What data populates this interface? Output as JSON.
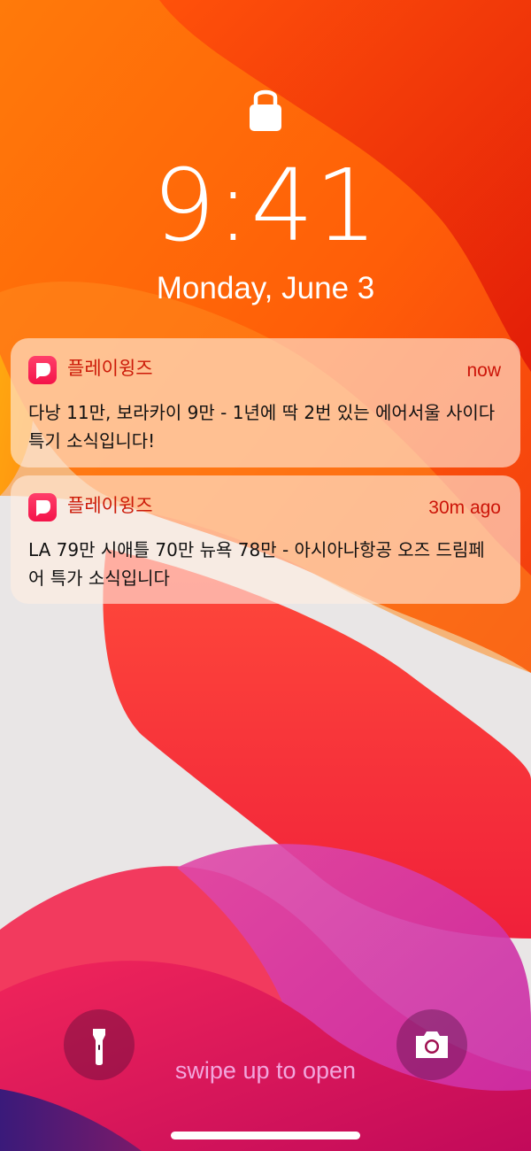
{
  "lockscreen": {
    "time": "9:41",
    "date": "Monday, June 3",
    "lock_icon": "lock-icon"
  },
  "notifications": [
    {
      "app_name": "플레이윙즈",
      "time": "now",
      "body": "다낭 11만, 보라카이 9만 - 1년에 딱 2번 있는 에어서울 사이다 특기 소식입니다!"
    },
    {
      "app_name": "플레이윙즈",
      "time": "30m ago",
      "body": "LA 79만 시애틀 70만 뉴욕 78만 - 아시아나항공 오즈 드림페어 특가 소식입니다"
    }
  ],
  "bottom": {
    "flashlight_icon": "flashlight-icon",
    "camera_icon": "camera-icon",
    "swipe_text": "swipe up to open"
  },
  "colors": {
    "accent_red": "#cc1a08",
    "app_icon": "#f4134a",
    "swipe_text": "#f2a6dd"
  }
}
